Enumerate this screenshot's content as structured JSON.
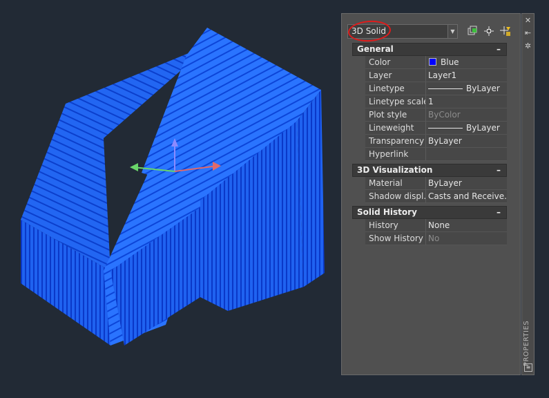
{
  "palette": {
    "title": "PROPERTIES",
    "object_type": "3D Solid",
    "icons": [
      "close-icon",
      "autohide-icon",
      "palette-settings-icon",
      "toggle-pickadd-icon",
      "select-objects-icon",
      "quick-select-icon"
    ],
    "sections": [
      {
        "title": "General",
        "collapse": "–",
        "rows": [
          {
            "name": "Color",
            "value": "Blue",
            "swatch": "#0000ff"
          },
          {
            "name": "Layer",
            "value": "Layer1"
          },
          {
            "name": "Linetype",
            "value": "ByLayer",
            "line": true
          },
          {
            "name": "Linetype scale",
            "value": "1"
          },
          {
            "name": "Plot style",
            "value": "ByColor",
            "dim": true
          },
          {
            "name": "Lineweight",
            "value": "ByLayer",
            "line": true
          },
          {
            "name": "Transparency",
            "value": "ByLayer"
          },
          {
            "name": "Hyperlink",
            "value": ""
          }
        ]
      },
      {
        "title": "3D Visualization",
        "collapse": "–",
        "rows": [
          {
            "name": "Material",
            "value": "ByLayer"
          },
          {
            "name": "Shadow displ...",
            "value": "Casts and Receive..."
          }
        ]
      },
      {
        "title": "Solid History",
        "collapse": "–",
        "rows": [
          {
            "name": "History",
            "value": "None"
          },
          {
            "name": "Show History",
            "value": "No",
            "dim": true
          }
        ]
      }
    ]
  },
  "colors": {
    "model_blue": "#1f6cff",
    "model_dark": "#0b3fd6",
    "background": "#222a35",
    "highlight_circle": "#e01b1b"
  }
}
